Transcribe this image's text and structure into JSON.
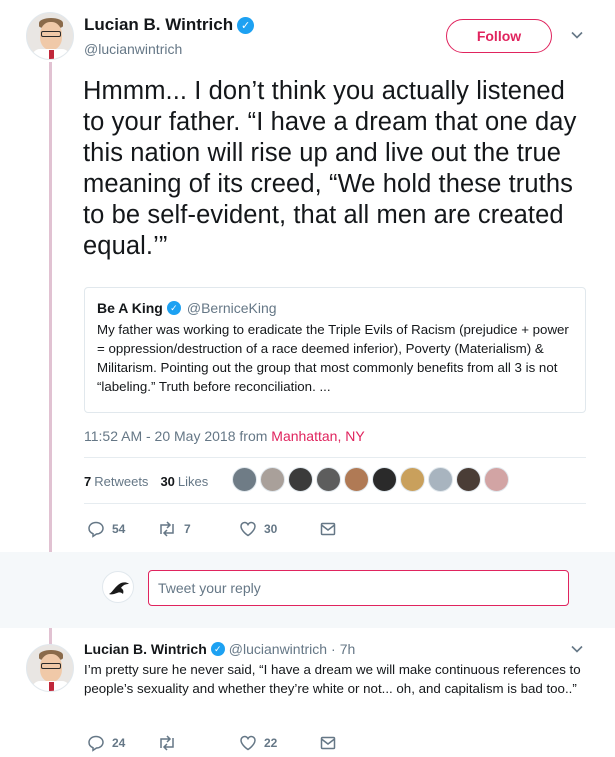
{
  "main_tweet": {
    "author": {
      "display_name": "Lucian B. Wintrich",
      "handle": "@lucianwintrich",
      "verified": true
    },
    "follow_label": "Follow",
    "text": "Hmmm... I don’t think you actually listened to your father. “I have a dream that one day this nation will rise up and live out the true meaning of its creed, “We hold these truths to be self-evident, that all men are created equal.’”",
    "quoted": {
      "display_name": "Be A King",
      "handle": "@BerniceKing",
      "verified": true,
      "text": "My father was working to eradicate the Triple Evils of Racism (prejudice + power = oppression/destruction of a race deemed inferior), Poverty (Materialism) & Militarism. Pointing out the group that most commonly benefits from all 3 is not “labeling.” Truth before reconciliation. ..."
    },
    "timestamp": "11:52 AM - 20 May 2018",
    "from_word": "from",
    "location": "Manhattan, NY",
    "stats": {
      "retweets_count": "7",
      "retweets_label": "Retweets",
      "likes_count": "30",
      "likes_label": "Likes"
    },
    "likers": [
      "#6f7c86",
      "#a9a09a",
      "#3b3b3b",
      "#5d5d5d",
      "#b07a55",
      "#2a2a2a",
      "#c9a05c",
      "#a8b4bf",
      "#4a3d36",
      "#d2a4a4"
    ],
    "actions": {
      "replies": "54",
      "retweets": "7",
      "likes": "30"
    }
  },
  "reply_composer": {
    "placeholder": "Tweet your reply"
  },
  "reply_tweet": {
    "author": {
      "display_name": "Lucian B. Wintrich",
      "handle": "@lucianwintrich",
      "verified": true
    },
    "separator": "·",
    "time": "7h",
    "text": "I’m pretty sure he never said, “I have a dream we will make continuous references to people’s sexuality and whether they’re white or not... oh, and capitalism is bad too..”",
    "actions": {
      "replies": "24",
      "retweets": "",
      "likes": "22"
    }
  },
  "icons": {
    "verified": "verified-check-icon",
    "chevron": "chevron-down-icon",
    "reply": "reply-bubble-icon",
    "retweet": "retweet-arrows-icon",
    "like": "heart-icon",
    "dm": "envelope-icon"
  },
  "colors": {
    "accent": "#e0245e",
    "verified": "#1da1f2",
    "muted": "#657786",
    "thread_line": "#e1c2d2"
  }
}
